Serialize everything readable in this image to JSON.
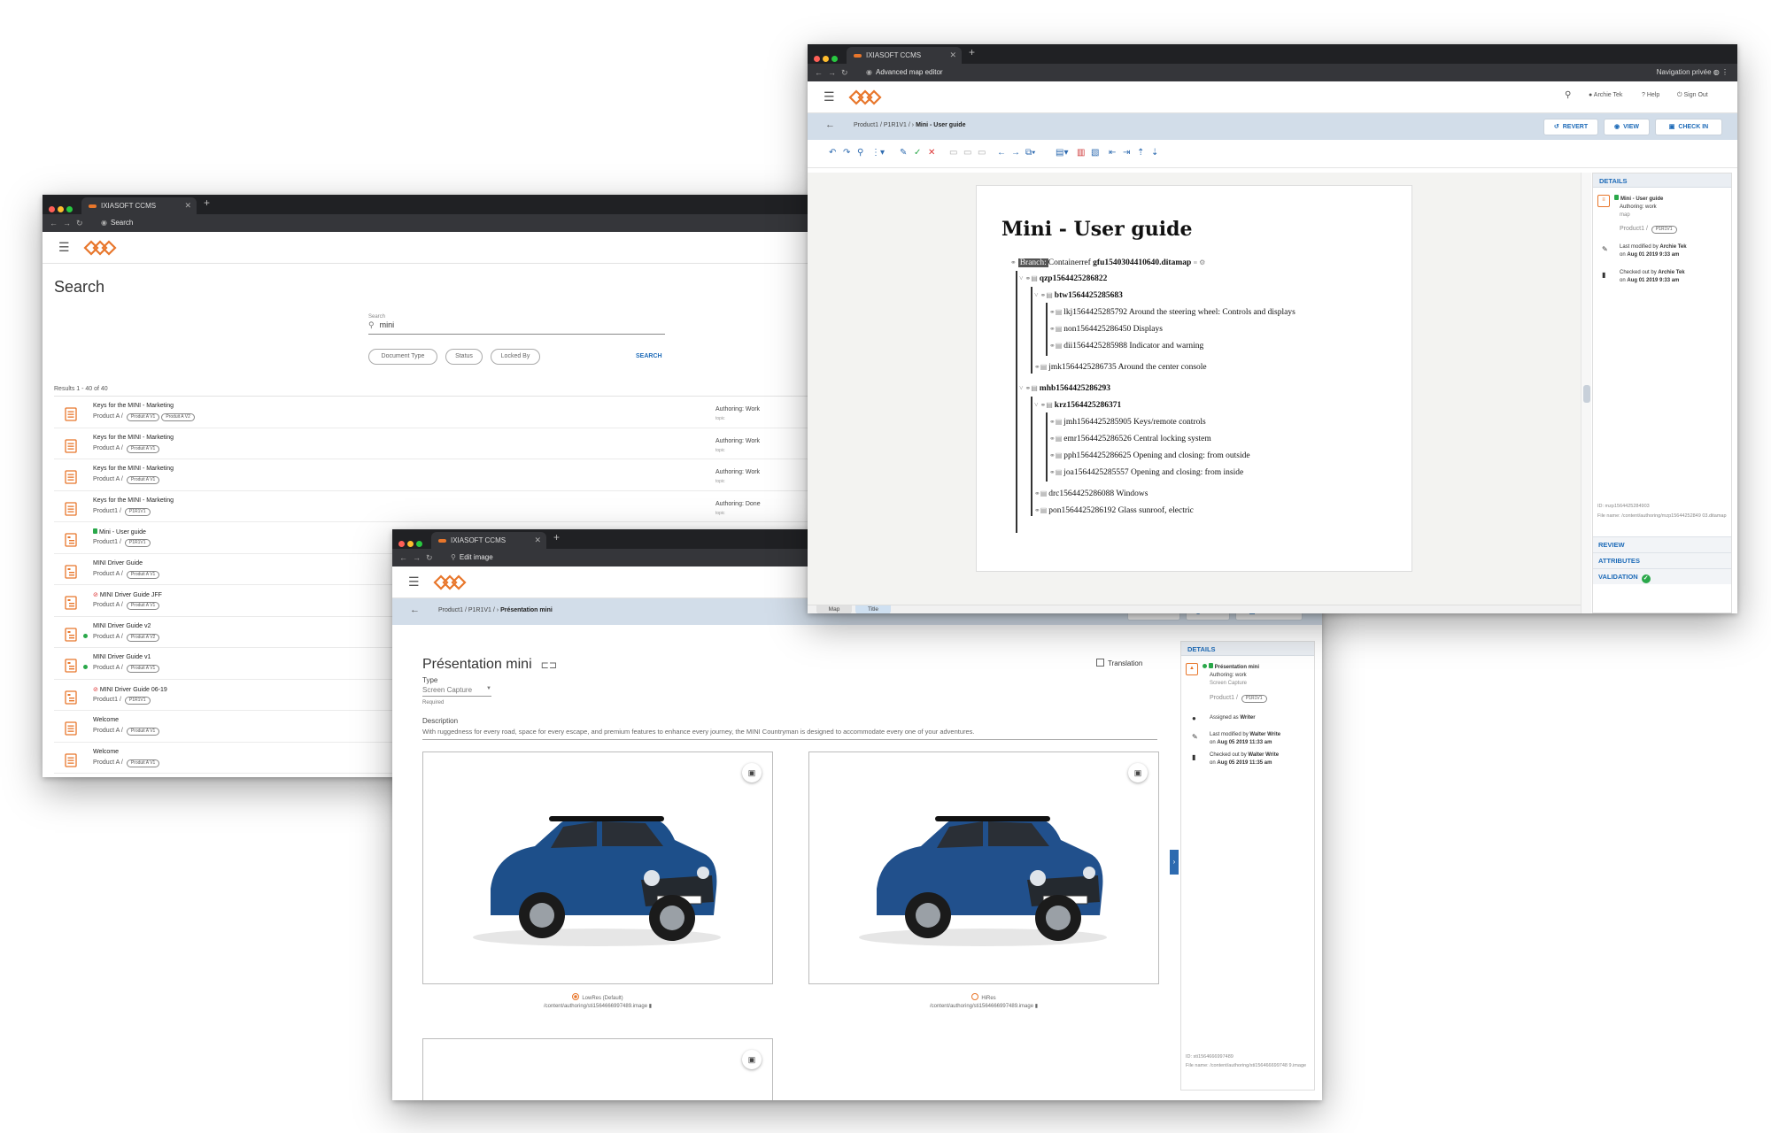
{
  "brand": {
    "accent": "#e8762b",
    "link": "#1e6bb8",
    "bar": "#d2dde9",
    "ok": "#2aa84a"
  },
  "search_window": {
    "tab_title": "IXIASOFT CCMS",
    "url": "Search",
    "page_title": "Search",
    "search_label": "Search",
    "search_value": "mini",
    "filters": [
      "Document Type",
      "Status",
      "Locked By"
    ],
    "search_button": "SEARCH",
    "results_count": "Results 1 - 40 of 40",
    "results": [
      {
        "title": "Keys for the MINI - Marketing",
        "path": "Product A /",
        "versions": [
          "Produit A V1",
          "Produit A V2"
        ],
        "status": "Authoring: Work",
        "type": "topic",
        "icon": "topic-icon"
      },
      {
        "title": "Keys for the MINI - Marketing",
        "path": "Product A /",
        "versions": [
          "Produit A V1"
        ],
        "status": "Authoring: Work",
        "type": "topic",
        "icon": "topic-icon"
      },
      {
        "title": "Keys for the MINI - Marketing",
        "path": "Product A /",
        "versions": [
          "Produit A V1"
        ],
        "status": "Authoring: Work",
        "type": "topic",
        "icon": "topic-icon"
      },
      {
        "title": "Keys for the MINI - Marketing",
        "path": "Product1 /",
        "versions": [
          "P1R1V1"
        ],
        "status": "Authoring: Done",
        "type": "topic",
        "icon": "topic-icon"
      },
      {
        "title": "Mini - User guide",
        "path": "Product1 /",
        "versions": [
          "P1R1V1"
        ],
        "status": "",
        "type": "",
        "icon": "map-icon",
        "mark": "lock"
      },
      {
        "title": "MINI Driver Guide",
        "path": "Product A /",
        "versions": [
          "Produit A V1"
        ],
        "status": "",
        "type": "",
        "icon": "map-icon"
      },
      {
        "title": "MINI Driver Guide JFF",
        "path": "Product A /",
        "versions": [
          "Produit A V1"
        ],
        "status": "",
        "type": "",
        "icon": "map-icon",
        "mark": "noentry"
      },
      {
        "title": "MINI Driver Guide v2",
        "path": "Product A /",
        "versions": [
          "Produit A V2"
        ],
        "status": "",
        "type": "",
        "icon": "map-icon",
        "mark": "dot"
      },
      {
        "title": "MINI Driver Guide v1",
        "path": "Product A /",
        "versions": [
          "Produit A V1"
        ],
        "status": "",
        "type": "",
        "icon": "map-icon",
        "mark": "dot"
      },
      {
        "title": "MINI Driver Guide 06-19",
        "path": "Product1 /",
        "versions": [
          "P1R1V1"
        ],
        "status": "",
        "type": "",
        "icon": "map-icon",
        "mark": "noentry"
      },
      {
        "title": "Welcome",
        "path": "Product A /",
        "versions": [
          "Produit A V1"
        ],
        "status": "",
        "type": "",
        "icon": "topic-icon"
      },
      {
        "title": "Welcome",
        "path": "Product A /",
        "versions": [
          "Produit A V1"
        ],
        "status": "",
        "type": "",
        "icon": "topic-icon"
      }
    ]
  },
  "image_window": {
    "tab_title": "IXIASOFT CCMS",
    "url": "Edit image",
    "breadcrumb": "Product1 / P1R1V1 /",
    "breadcrumb_current": "Présentation mini",
    "actions": [
      "REVERT",
      "VIEW",
      "CHECK IN"
    ],
    "title": "Présentation mini",
    "translation_label": "Translation",
    "type_label": "Type",
    "type_value": "Screen Capture",
    "required": "Required",
    "description_label": "Description",
    "description_value": "With ruggedness for every road, space for every escape, and premium features to enhance every journey, the MINI Countryman is designed to accommodate every one of your adventures.",
    "images": [
      {
        "resolution": "LowRes (Default)",
        "path": "/content/authoring/sti1564666997489.image",
        "selected": true
      },
      {
        "resolution": "HiRes",
        "path": "/content/authoring/sti1564666997489.image",
        "selected": false
      }
    ],
    "details": {
      "header": "DETAILS",
      "name": "Présentation mini",
      "status": "Authoring: work",
      "type": "Screen Capture",
      "product": "Product1 /",
      "version": "P1R1V1",
      "assigned": "Assigned as",
      "assigned_role": "Writer",
      "modified_by": "Last modified by",
      "modified_user": "Walter Write",
      "modified_on": "on",
      "modified_date": "Aug 05 2019 11:33 am",
      "checked_by": "Checked out by",
      "checked_user": "Walter Write",
      "checked_on": "on",
      "checked_date": "Aug 05 2019 11:35 am",
      "id": "ID: sti1564666997489",
      "file": "File name: /content/authoring/sti156466699748 9.image"
    }
  },
  "map_window": {
    "tab_title": "IXIASOFT CCMS",
    "url": "Advanced map editor",
    "private": "Navigation privée",
    "user": "Archie Tek",
    "help": "Help",
    "signout": "Sign Out",
    "breadcrumb": "Product1 / P1R1V1 /",
    "breadcrumb_current": "Mini - User guide",
    "actions": [
      "REVERT",
      "VIEW",
      "CHECK IN"
    ],
    "title": "Mini - User guide",
    "branch_label": "Branch:",
    "branch_value": "Containerref",
    "branch_file": "gfu1540304410640.ditamap",
    "tree": [
      {
        "id": "qzp1564425286822",
        "text": "",
        "level": 1,
        "bold": true
      },
      {
        "id": "btw1564425285683",
        "text": "",
        "level": 2,
        "bold": true
      },
      {
        "id": "lkj1564425285792",
        "text": "Around the steering wheel: Controls and displays",
        "level": 3
      },
      {
        "id": "non1564425286450",
        "text": "Displays",
        "level": 3
      },
      {
        "id": "dii1564425285988",
        "text": "Indicator and warning",
        "level": 3
      },
      {
        "id": "jmk1564425286735",
        "text": "Around the center console",
        "level": 2
      },
      {
        "id": "mhb1564425286293",
        "text": "",
        "level": 1,
        "bold": true
      },
      {
        "id": "krz1564425286371",
        "text": "",
        "level": 2,
        "bold": true
      },
      {
        "id": "jmh1564425285905",
        "text": "Keys/remote controls",
        "level": 3
      },
      {
        "id": "emr1564425286526",
        "text": "Central locking system",
        "level": 3
      },
      {
        "id": "pph1564425286625",
        "text": "Opening and closing: from outside",
        "level": 3
      },
      {
        "id": "joa1564425285557",
        "text": "Opening and closing: from inside",
        "level": 3
      },
      {
        "id": "drc1564425286088",
        "text": "Windows",
        "level": 2
      },
      {
        "id": "pon1564425286192",
        "text": "Glass sunroof, electric",
        "level": 2
      }
    ],
    "bottom_tabs": [
      "Map",
      "Title"
    ],
    "details": {
      "header": "DETAILS",
      "name": "Mini - User guide",
      "status": "Authoring: work",
      "type": "map",
      "product": "Product1 /",
      "version": "P1R1V1",
      "modified_by": "Last modified by",
      "modified_user": "Archie Tek",
      "modified_on": "on",
      "modified_date": "Aug 01 2019 9:33 am",
      "checked_by": "Checked out by",
      "checked_user": "Archie Tek",
      "checked_on": "on",
      "checked_date": "Aug 01 2019 9:33 am",
      "id": "ID: mzp1564425284903",
      "file": "File name: /content/authoring/mzp15644252849 03.ditamap",
      "sections": [
        "REVIEW",
        "ATTRIBUTES",
        "VALIDATION"
      ]
    }
  }
}
